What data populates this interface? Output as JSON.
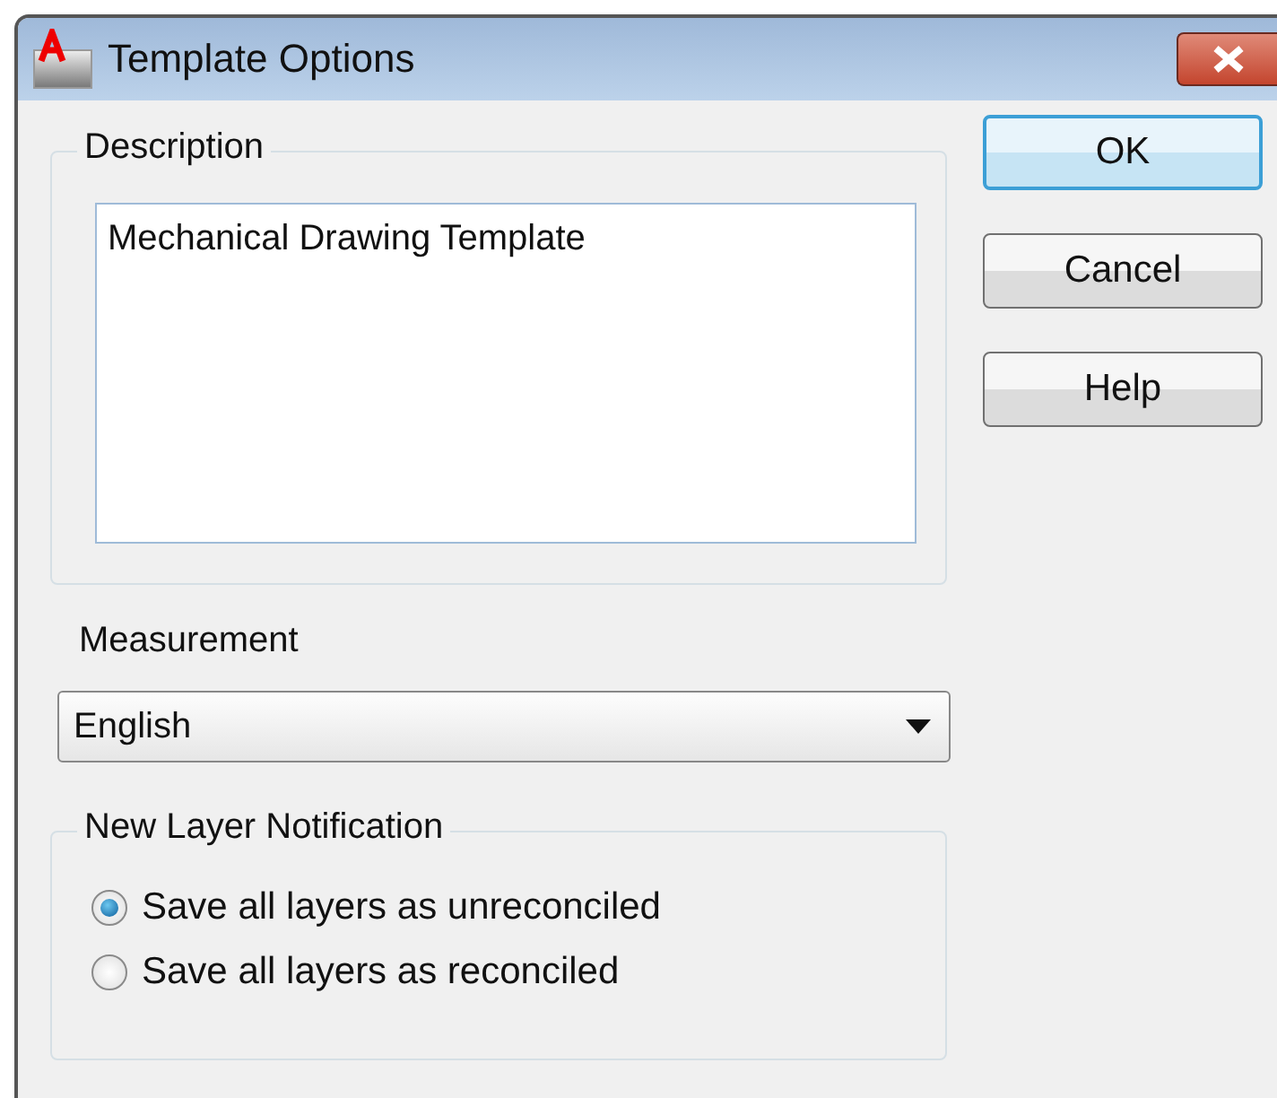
{
  "window": {
    "title": "Template Options"
  },
  "description": {
    "label": "Description",
    "value": "Mechanical Drawing Template"
  },
  "buttons": [
    {
      "label": "OK",
      "default": true
    },
    {
      "label": "Cancel",
      "default": false
    },
    {
      "label": "Help",
      "default": false
    }
  ],
  "measurement": {
    "label": "Measurement",
    "value": "English"
  },
  "layer_notification": {
    "label": "New Layer Notification",
    "options": [
      {
        "label": "Save all layers as unreconciled",
        "selected": true
      },
      {
        "label": "Save all layers as reconciled",
        "selected": false
      }
    ]
  }
}
